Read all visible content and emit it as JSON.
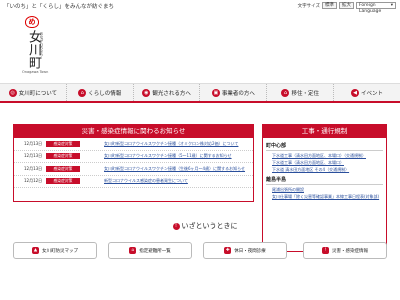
{
  "header": {
    "tagline_prefix": "「いのち」と「くらし」をみんなが",
    "tagline_highlight": "",
    "tagline_full": "「いのち」と「くらし」をみんなが紡ぐまち",
    "text_size_label": "文字サイズ",
    "standard_button": "標準",
    "enlarge_button": "拡大",
    "language_select": "Foreign Language",
    "language_caret": "▾"
  },
  "logo": {
    "emblem_glyph": "め",
    "town_name": "女川町",
    "kana": "おながわちょう",
    "roman": "Onagawa Town"
  },
  "nav": {
    "items": [
      {
        "label": "女川町について",
        "icon": "town-icon",
        "glyph": "◎"
      },
      {
        "label": "くらしの情報",
        "icon": "home-icon",
        "glyph": "⌂"
      },
      {
        "label": "観光される方へ",
        "icon": "camera-icon",
        "glyph": "◉"
      },
      {
        "label": "事業者の方へ",
        "icon": "briefcase-icon",
        "glyph": "▣"
      },
      {
        "label": "移住・定住",
        "icon": "house-icon",
        "glyph": "⌂"
      },
      {
        "label": "イベント",
        "icon": "megaphone-icon",
        "glyph": "◀"
      }
    ]
  },
  "disaster": {
    "title": "災害・感染症情報に関わるお知らせ",
    "rows": [
      {
        "date": "12月13日",
        "badge": "感染症対策",
        "text": "女川町新型コロナウイルスワクチン接種（オミクロン株対応2価）について"
      },
      {
        "date": "12月13日",
        "badge": "感染症対策",
        "text": "女川町新型コロナウイルスワクチン接種（5～11歳）に関するお知らせ"
      },
      {
        "date": "12月13日",
        "badge": "感染症対策",
        "text": "女川町新型コロナウイルスワクチン接種（生後6ヶ月～4歳）に関するお知らせ"
      },
      {
        "date": "12月12日",
        "badge": "感染症対策",
        "text": "新型コロナウイルス感染症の患者発生について"
      }
    ]
  },
  "works": {
    "title": "工事・通行規制",
    "section1": "町中心部",
    "items1": [
      "下水道工事（清水田方面地区、本場口）（交通規制）",
      "下水道工事（清水田方面地区、本場口）",
      "下水道 清水田方面地区 その4（交通規制）"
    ],
    "section2": "離島半島",
    "items2": [
      "尾浦出張所の開設",
      "女川仕事場「除く災害等確認事業」本線工事日程表(対象部)"
    ]
  },
  "emergency": {
    "title": "いざというときに",
    "buttons": [
      {
        "label": "女川町防災マップ",
        "icon": "map-icon",
        "glyph": "▲"
      },
      {
        "label": "指定避難所一覧",
        "icon": "shelter-icon",
        "glyph": "⌂"
      },
      {
        "label": "休日・夜間診療",
        "icon": "clinic-icon",
        "glyph": "✚"
      },
      {
        "label": "災害・感染症情報",
        "icon": "alert-icon",
        "glyph": "!"
      }
    ]
  }
}
